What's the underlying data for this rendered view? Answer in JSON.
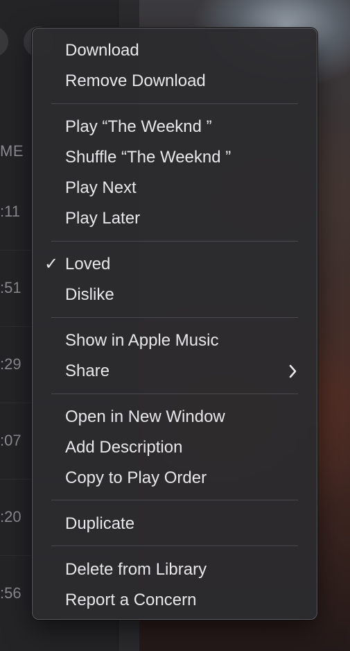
{
  "background": {
    "column_header": "ME",
    "time_cells": [
      ":11",
      ":51",
      ":29",
      ":07",
      ":20",
      ":56"
    ]
  },
  "menu": {
    "groups": [
      {
        "items": [
          {
            "label": "Download"
          },
          {
            "label": "Remove Download"
          }
        ]
      },
      {
        "items": [
          {
            "label": "Play “The Weeknd ”"
          },
          {
            "label": "Shuffle “The Weeknd ”"
          },
          {
            "label": "Play Next"
          },
          {
            "label": "Play Later"
          }
        ]
      },
      {
        "items": [
          {
            "label": "Loved",
            "checked": true,
            "check_glyph": "✓"
          },
          {
            "label": "Dislike"
          }
        ]
      },
      {
        "items": [
          {
            "label": "Show in Apple Music"
          },
          {
            "label": "Share",
            "submenu": true
          }
        ]
      },
      {
        "items": [
          {
            "label": "Open in New Window"
          },
          {
            "label": "Add Description"
          },
          {
            "label": "Copy to Play Order"
          }
        ]
      },
      {
        "items": [
          {
            "label": "Duplicate"
          }
        ]
      },
      {
        "items": [
          {
            "label": "Delete from Library"
          },
          {
            "label": "Report a Concern"
          }
        ]
      }
    ]
  }
}
